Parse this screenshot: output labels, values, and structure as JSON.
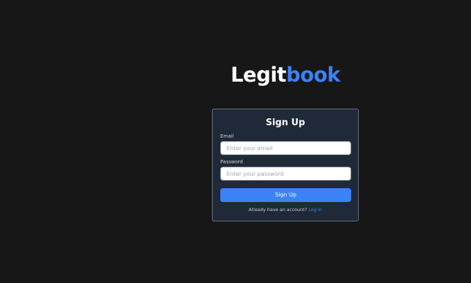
{
  "brand": {
    "part1": "Legit",
    "part2": "book",
    "part1_color": "#ffffff",
    "part2_color": "#3b82f6"
  },
  "form": {
    "title": "Sign Up",
    "email_label": "Email",
    "email_placeholder": "Enter your email",
    "email_value": "",
    "password_label": "Password",
    "password_placeholder": "Enter your password",
    "password_value": "",
    "submit_label": "Sign Up",
    "footer_text": "Already have an account?",
    "footer_link": "Log In"
  },
  "colors": {
    "background": "#171717",
    "card": "#1f2937",
    "accent": "#3b82f6"
  }
}
